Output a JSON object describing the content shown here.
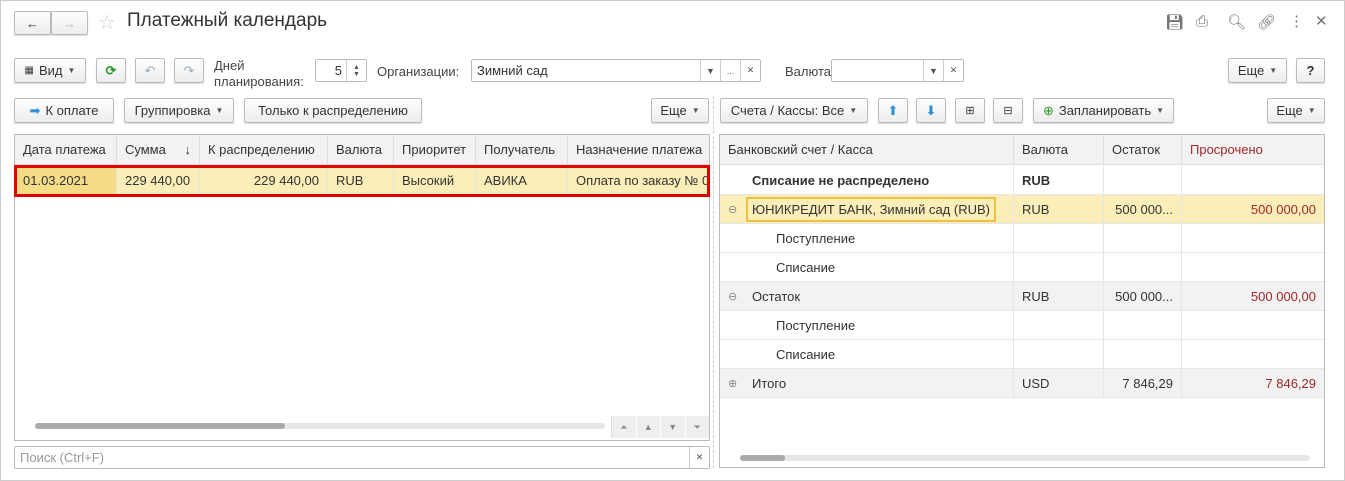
{
  "window": {
    "title": "Платежный календарь"
  },
  "toolbar": {
    "view": "Вид",
    "days_label_1": "Дней",
    "days_label_2": "планирования:",
    "days_value": "5",
    "org_label": "Организации:",
    "org_value": "Зимний сад",
    "org_more": "...",
    "currency_label": "Валюта:",
    "currency_value": "",
    "more": "Еще",
    "help": "?"
  },
  "left": {
    "pay_btn": "К оплате",
    "group_btn": "Группировка",
    "only_dist_btn": "Только к распределению",
    "more": "Еще",
    "columns": [
      "Дата платежа",
      "Сумма",
      "К распределению",
      "Валюта",
      "Приоритет",
      "Получатель",
      "Назначение платежа"
    ],
    "rows": [
      [
        "01.03.2021",
        "229 440,00",
        "229 440,00",
        "RUB",
        "Высокий",
        "АВИКА",
        "Оплата по заказу № 0"
      ]
    ],
    "search_placeholder": "Поиск (Ctrl+F)"
  },
  "right": {
    "accounts_btn": "Счета / Кассы: Все",
    "plan_btn": "Запланировать",
    "more": "Еще",
    "columns": [
      "Банковский счет / Касса",
      "Валюта",
      "Остаток",
      "Просрочено"
    ],
    "rows": [
      {
        "name": "Списание не распределено",
        "cur": "RUB",
        "bal": "",
        "over": ""
      },
      {
        "name": "ЮНИКРЕДИТ БАНК, Зимний сад (RUB)",
        "cur": "RUB",
        "bal": "500 000...",
        "over": "500 000,00"
      },
      {
        "name": "Поступление",
        "cur": "",
        "bal": "",
        "over": ""
      },
      {
        "name": "Списание",
        "cur": "",
        "bal": "",
        "over": ""
      },
      {
        "name": "Остаток",
        "cur": "RUB",
        "bal": "500 000...",
        "over": "500 000,00"
      },
      {
        "name": "Поступление",
        "cur": "",
        "bal": "",
        "over": ""
      },
      {
        "name": "Списание",
        "cur": "",
        "bal": "",
        "over": ""
      },
      {
        "name": "Итого",
        "cur": "USD",
        "bal": "7 846,29",
        "over": "7 846,29"
      }
    ]
  },
  "colors": {
    "accent_red": "#e00000",
    "selected": "#fbeeb8",
    "overdue": "#a0282a"
  }
}
